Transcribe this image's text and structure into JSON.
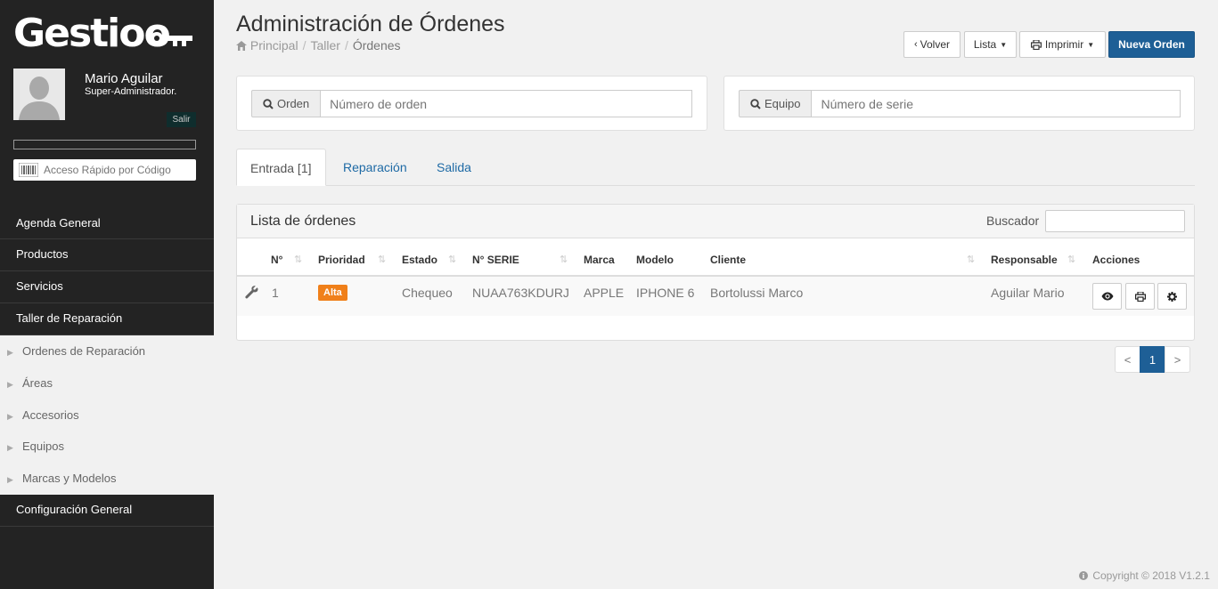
{
  "sidebar": {
    "logo": "Gestioo",
    "user_name": "Mario Aguilar",
    "user_role": "Super-Administrador.",
    "logout_label": "Salir",
    "quick_access_placeholder": "Acceso Rápido por Código",
    "nav": {
      "agenda": "Agenda General",
      "productos": "Productos",
      "servicios": "Servicios",
      "taller": "Taller de Reparación",
      "sub": [
        "Ordenes de Reparación",
        "Áreas",
        "Accesorios",
        "Equipos",
        "Marcas y Modelos"
      ],
      "config": "Configuración General"
    }
  },
  "header": {
    "title": "Administración de Órdenes",
    "breadcrumb": [
      "Principal",
      "Taller",
      "Órdenes"
    ],
    "buttons": {
      "volver": "Volver",
      "lista": "Lista",
      "imprimir": "Imprimir",
      "nueva": "Nueva Orden"
    }
  },
  "search": {
    "orden_label": "Orden",
    "orden_placeholder": "Número de orden",
    "equipo_label": "Equipo",
    "equipo_placeholder": "Número de serie"
  },
  "tabs": [
    "Entrada [1]",
    "Reparación",
    "Salida"
  ],
  "table": {
    "title": "Lista de órdenes",
    "search_label": "Buscador",
    "columns": [
      "N°",
      "Prioridad",
      "Estado",
      "N° SERIE",
      "Marca",
      "Modelo",
      "Cliente",
      "Responsable",
      "Acciones"
    ],
    "rows": [
      {
        "num": "1",
        "prioridad": "Alta",
        "estado": "Chequeo",
        "serie": "NUAA763KDURJ",
        "marca": "APPLE",
        "modelo": "IPHONE 6",
        "cliente": "Bortolussi Marco",
        "responsable": "Aguilar Mario"
      }
    ]
  },
  "pagination": {
    "prev": "<",
    "current": "1",
    "next": ">"
  },
  "footer": {
    "copyright": "Copyright © 2018 V1.2.1"
  },
  "colors": {
    "primary": "#1e5f96",
    "sidebar": "#232323",
    "badge_high": "#f0801a",
    "link": "#1e6aa5"
  }
}
